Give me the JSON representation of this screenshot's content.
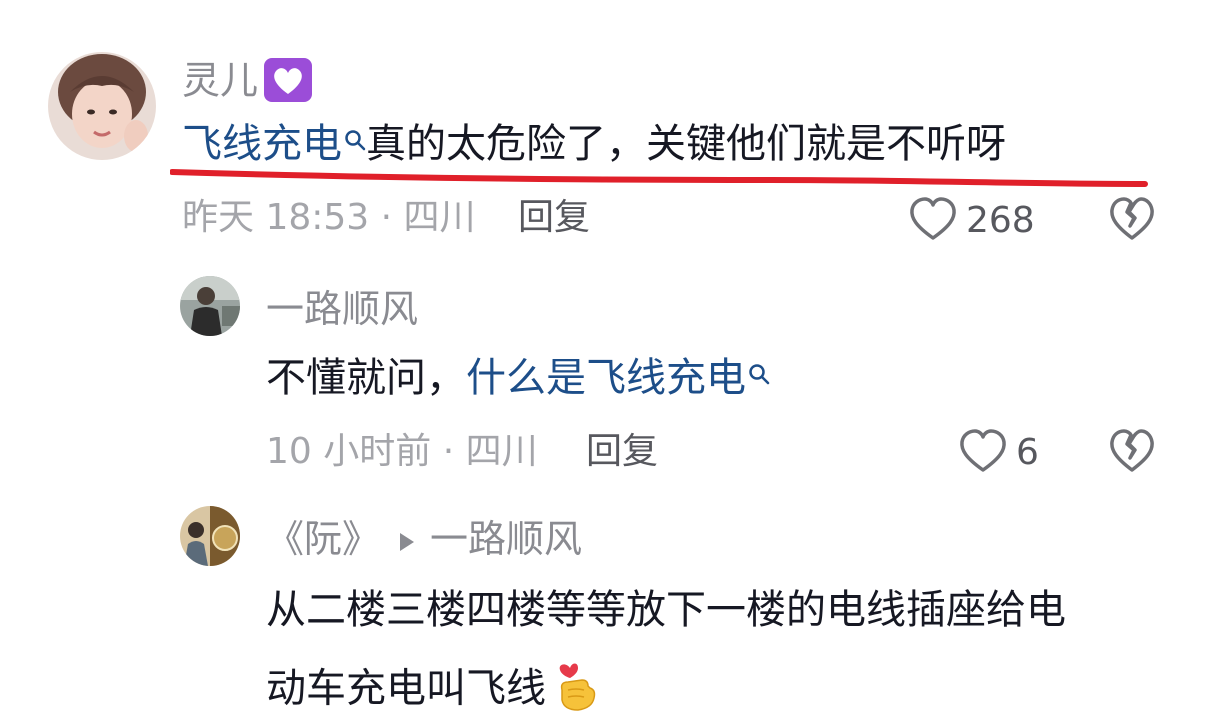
{
  "comments": [
    {
      "username": "灵儿",
      "badge_icon": "purple-heart-icon",
      "text_link": "飞线充电",
      "text_rest": "真的太危险了，关键他们就是不听呀",
      "meta": "昨天 18:53 · 四川",
      "reply_label": "回复",
      "likes": "268"
    },
    {
      "username": "一路顺风",
      "text_plain": "不懂就问，",
      "text_link": "什么是飞线充电",
      "meta": "10 小时前 · 四川",
      "reply_label": "回复",
      "likes": "6"
    },
    {
      "username": "《阮》",
      "reply_to": "一路顺风",
      "text_line1": "从二楼三楼四楼等等放下一楼的电线插座给电",
      "text_line2": "动车充电叫飞线",
      "emoji_icon": "finger-heart-emoji-icon"
    }
  ],
  "colors": {
    "link": "#1d4e89",
    "underline": "#e0202a",
    "meta": "#a4a5aa",
    "username": "#8a8b91"
  }
}
